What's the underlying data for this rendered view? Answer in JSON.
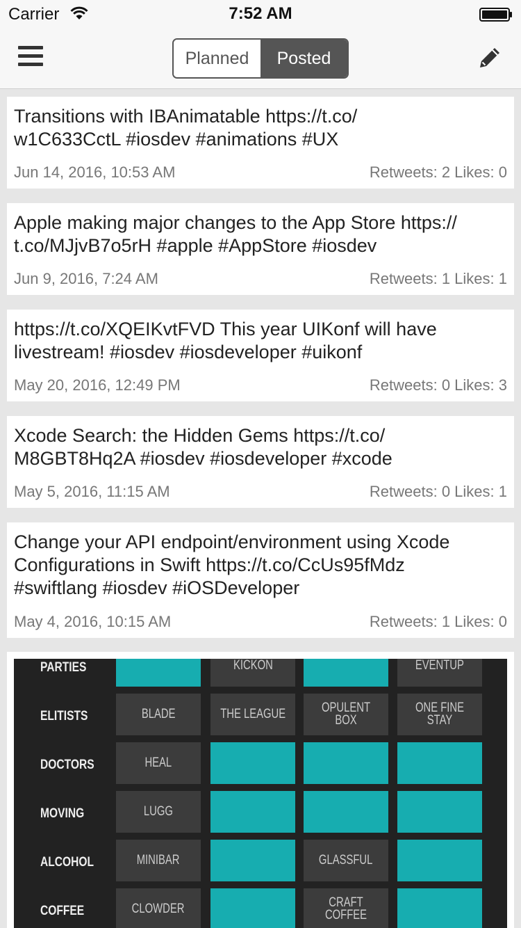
{
  "status": {
    "carrier": "Carrier",
    "time": "7:52 AM"
  },
  "nav": {
    "segments": {
      "planned": "Planned",
      "posted": "Posted"
    },
    "selected": "Posted",
    "menu_icon": "hamburger-menu-icon",
    "edit_icon": "pencil-icon"
  },
  "posts": [
    {
      "text": "Transitions with IBAnimatable https://t.co/\nw1C633CctL #iosdev #animations #UX",
      "date": "Jun 14, 2016, 10:53 AM",
      "stats": "Retweets: 2 Likes: 0"
    },
    {
      "text": "Apple making major changes to the App Store https://\nt.co/MJjvB7o5rH #apple #AppStore #iosdev",
      "date": "Jun 9, 2016, 7:24 AM",
      "stats": "Retweets: 1 Likes: 1"
    },
    {
      "text": "https://t.co/XQEIKvtFVD This year UIKonf will have\nlivestream! #iosdev #iosdeveloper #uikonf",
      "date": "May 20, 2016, 12:49 PM",
      "stats": "Retweets: 0 Likes: 3"
    },
    {
      "text": "Xcode Search: the Hidden Gems https://t.co/\nM8GBT8Hq2A #iosdev #iosdeveloper #xcode",
      "date": "May 5, 2016, 11:15 AM",
      "stats": "Retweets: 0 Likes: 1"
    },
    {
      "text": "Change your API endpoint/environment using Xcode\nConfigurations in Swift https://t.co/CcUs95fMdz\n#swiftlang #iosdev #iOSDeveloper",
      "date": "May 4, 2016, 10:15 AM",
      "stats": "Retweets: 1 Likes: 0"
    }
  ],
  "image_grid": {
    "rows": [
      {
        "label": "PARTIES",
        "cells": [
          "",
          "KICKON",
          "",
          "EVENTUP"
        ]
      },
      {
        "label": "ELITISTS",
        "cells": [
          "BLADE",
          "THE LEAGUE",
          "OPULENT BOX",
          "ONE FINE STAY"
        ]
      },
      {
        "label": "DOCTORS",
        "cells": [
          "HEAL",
          "",
          "",
          ""
        ]
      },
      {
        "label": "MOVING",
        "cells": [
          "LUGG",
          "",
          "",
          ""
        ]
      },
      {
        "label": "ALCOHOL",
        "cells": [
          "MINIBAR",
          "",
          "GLASSFUL",
          ""
        ]
      },
      {
        "label": "COFFEE",
        "cells": [
          "CLOWDER",
          "",
          "CRAFT COFFEE",
          ""
        ]
      }
    ],
    "colors": {
      "teal": "#17adb0",
      "dark": "#3c3c3c",
      "background": "#222222"
    }
  }
}
